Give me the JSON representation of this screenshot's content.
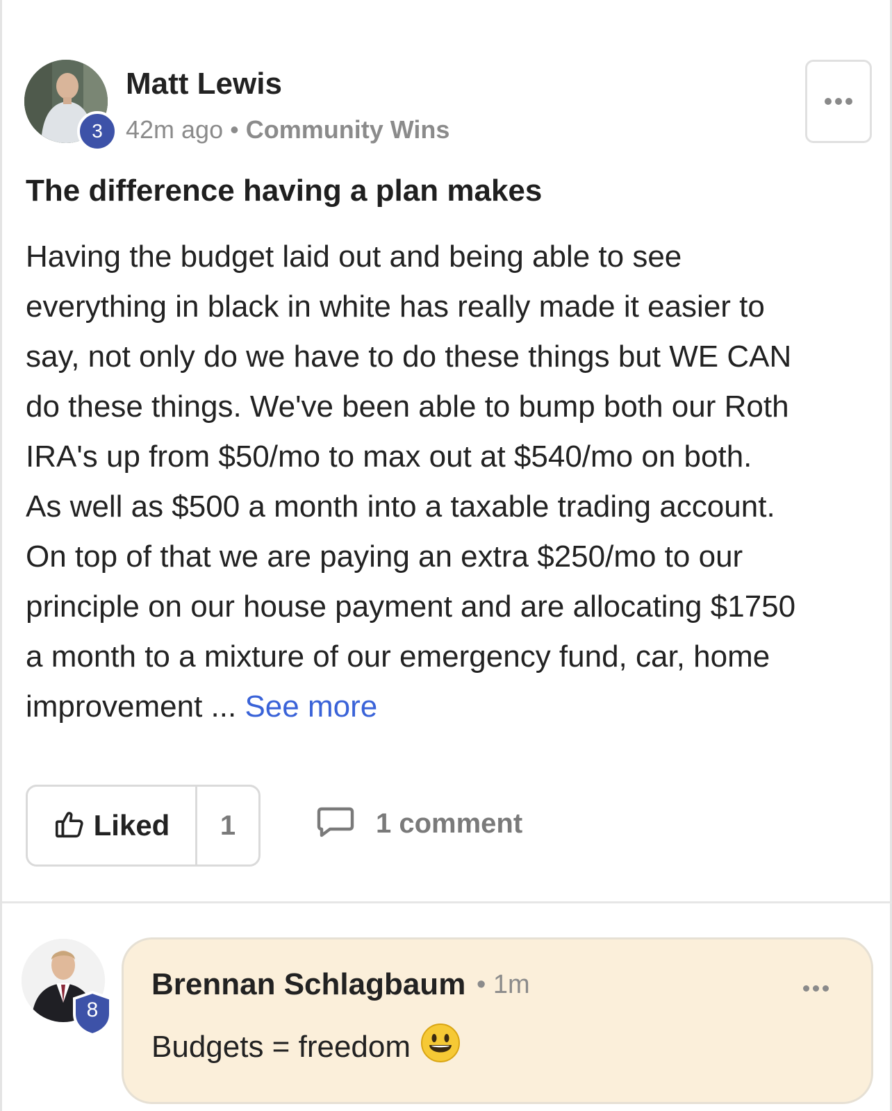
{
  "post": {
    "author": {
      "name": "Matt Lewis",
      "level": "3"
    },
    "time": "42m ago",
    "separator": "•",
    "category": "Community Wins",
    "title": "The difference having a plan makes",
    "body_lines": [
      "Having the budget laid out and being able to see",
      "everything in black in white has really made it easier to",
      "say, not only do we have to do these things but WE CAN",
      "do these things. We've been able to bump both our Roth",
      "IRA's up from $50/mo to max out at $540/mo on both.",
      "As well as $500 a month into a taxable trading account.",
      "On top of that we are paying an extra $250/mo to our",
      "principle on our house payment and are allocating $1750",
      "a month to a mixture of our emergency fund, car, home"
    ],
    "body_last": "improvement ... ",
    "see_more": "See more"
  },
  "actions": {
    "like_label": "Liked",
    "like_count": "1",
    "comment_label": "1 comment"
  },
  "comment": {
    "author": "Brennan Schlagbaum",
    "level": "8",
    "separator": "•",
    "time": "1m",
    "text": "Budgets = freedom"
  },
  "icons": {
    "like": "thumbs-up-icon",
    "comment": "speech-bubble-icon",
    "more": "ellipsis-icon",
    "emoji": "smiley-emoji"
  },
  "colors": {
    "level_badge": "#3d52a8",
    "link": "#3a63d8",
    "comment_bubble": "#fbefda"
  }
}
